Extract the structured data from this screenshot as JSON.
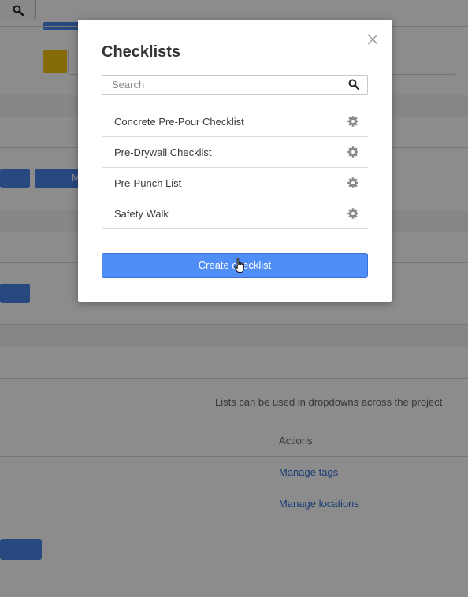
{
  "modal": {
    "title": "Checklists",
    "search_placeholder": "Search",
    "items": [
      {
        "label": "Concrete Pre-Pour Checklist"
      },
      {
        "label": "Pre-Drywall Checklist"
      },
      {
        "label": "Pre-Punch List"
      },
      {
        "label": "Safety Walk"
      }
    ],
    "create_button_label": "Create checklist"
  },
  "background": {
    "button_fragment": "M",
    "lists_hint": "Lists can be used in dropdowns across the project",
    "actions_header": "Actions",
    "links": [
      "Manage tags",
      "Manage locations"
    ]
  },
  "icons": {
    "close": "close-icon",
    "search": "search-icon",
    "settings": "gear-icon",
    "pointer": "hand-pointer-cursor"
  },
  "colors": {
    "primary_button": "#4f8ef7",
    "link": "#2f6fd6",
    "highlight_yellow": "#f1c40f"
  }
}
